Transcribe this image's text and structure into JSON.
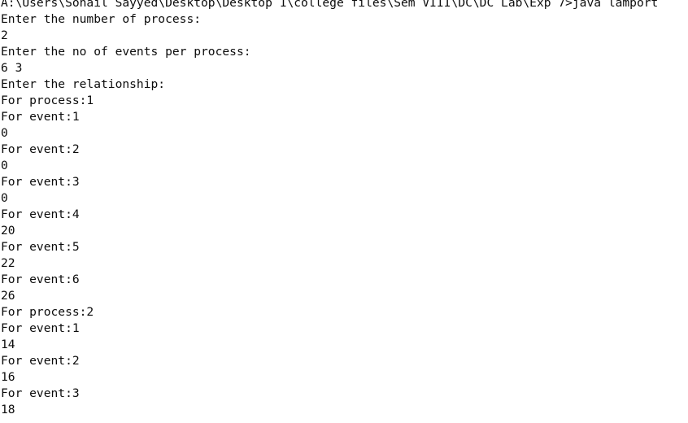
{
  "terminal": {
    "lines": [
      "A:\\Users\\Sohail Sayyed\\Desktop\\Desktop 1\\college files\\Sem VIII\\DC\\DC Lab\\Exp 7>java lamport",
      "Enter the number of process:",
      "2",
      "Enter the no of events per process:",
      "6 3",
      "Enter the relationship:",
      "For process:1",
      "For event:1",
      "0",
      "For event:2",
      "0",
      "For event:3",
      "0",
      "For event:4",
      "20",
      "For event:5",
      "22",
      "For event:6",
      "26",
      "For process:2",
      "For event:1",
      "14",
      "For event:2",
      "16",
      "For event:3",
      "18"
    ]
  },
  "colors": {
    "background": "#ffffff",
    "text": "#0c0c0c"
  }
}
